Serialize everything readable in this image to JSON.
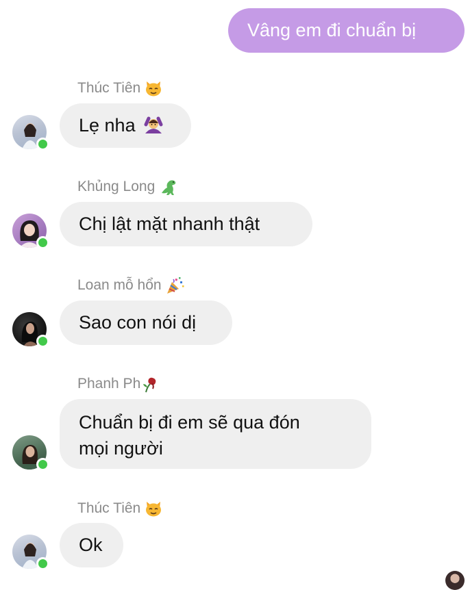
{
  "outgoing": {
    "text": "Vâng em đi chuẩn bị"
  },
  "messages": [
    {
      "sender": "Thúc Tiên",
      "sender_emoji": "cat-face-icon",
      "text": "Lẹ nha",
      "text_emoji": "woman-gesturing-ok-icon"
    },
    {
      "sender": "Khủng Long",
      "sender_emoji": "t-rex-icon",
      "text": "Chị lật mặt nhanh thật"
    },
    {
      "sender": "Loan mỗ hổn",
      "sender_emoji": "party-popper-icon",
      "text": "Sao con nói dị"
    },
    {
      "sender": "Phanh Ph",
      "sender_emoji": "wilted-rose-icon",
      "text_line1": "Chuẩn bị đi em sẽ qua đón",
      "text_line2": "mọi người"
    },
    {
      "sender": "Thúc Tiên",
      "sender_emoji": "cat-face-icon",
      "text": "Ok"
    }
  ],
  "colors": {
    "outgoing_bubble": "#c59be6",
    "incoming_bubble": "#efefef",
    "sender_name": "#8a8a8a",
    "online_dot": "#42c94a"
  }
}
